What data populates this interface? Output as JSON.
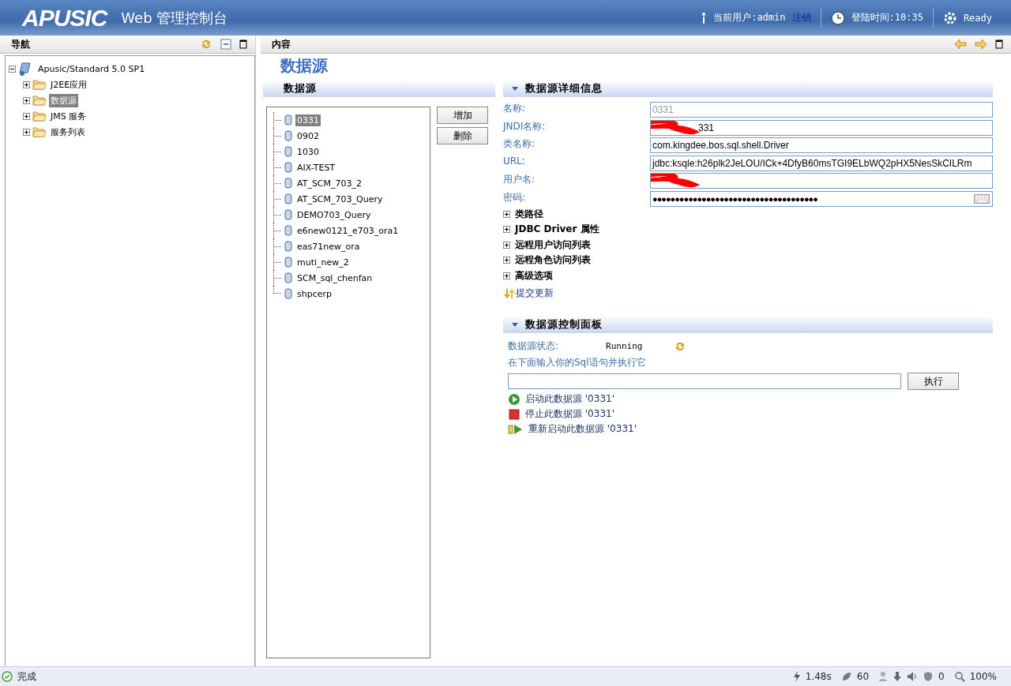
{
  "header": {
    "logo": "APUSIC",
    "title": "Web 管理控制台",
    "user_label": "当前用户:admin",
    "logout": "注销",
    "login_time": "登陆时间:10:35",
    "status": "Ready"
  },
  "nav": {
    "title": "导航",
    "tree": {
      "label": "Apusic/Standard 5.0 SP1",
      "expanded": true,
      "children": [
        {
          "label": "J2EE应用",
          "expanded": false,
          "selected": false
        },
        {
          "label": "数据源",
          "expanded": false,
          "selected": true
        },
        {
          "label": "JMS 服务",
          "expanded": false,
          "selected": false
        },
        {
          "label": "服务列表",
          "expanded": false,
          "selected": false
        }
      ]
    }
  },
  "content": {
    "title": "内容",
    "page_title": "数据源",
    "list_panel": {
      "title": "数据源",
      "items": [
        {
          "label": "0331",
          "selected": true
        },
        {
          "label": "0902",
          "selected": false
        },
        {
          "label": "1030",
          "selected": false
        },
        {
          "label": "AIX-TEST",
          "selected": false
        },
        {
          "label": "AT_SCM_703_2",
          "selected": false
        },
        {
          "label": "AT_SCM_703_Query",
          "selected": false
        },
        {
          "label": "DEMO703_Query",
          "selected": false
        },
        {
          "label": "e6new0121_e703_ora1",
          "selected": false
        },
        {
          "label": "eas71new_ora",
          "selected": false
        },
        {
          "label": "muti_new_2",
          "selected": false
        },
        {
          "label": "SCM_sql_chenfan",
          "selected": false
        },
        {
          "label": "shpcerp",
          "selected": false
        }
      ],
      "buttons": [
        "增加",
        "删除"
      ]
    },
    "detail_panel": {
      "title": "数据源详细信息",
      "expanded": true,
      "fields": [
        {
          "label": "名称:",
          "value": "0331",
          "kind": "disabled",
          "redacted": false
        },
        {
          "label": "JNDI名称:",
          "value": "331",
          "kind": "text",
          "redacted": true
        },
        {
          "label": "类名称:",
          "value": "com.kingdee.bos.sql.shell.Driver",
          "kind": "text",
          "redacted": false
        },
        {
          "label": "URL:",
          "value": "jdbc:ksqle:h26plk2JeLOU/ICk+4DfyB60msTGI9ELbWQ2pHX5NesSkCILRm",
          "kind": "text",
          "redacted": false
        },
        {
          "label": "用户名:",
          "kind": "text",
          "redacted": true
        },
        {
          "label": "密码:",
          "value": "●●●●●●●●●●●●●●●●●●●●●●●●●●●●●●●●●●●●●",
          "kind": "password",
          "redacted": false
        }
      ],
      "sections": [
        {
          "label": "类路径",
          "expanded": false
        },
        {
          "label": "JDBC Driver 属性",
          "expanded": false
        },
        {
          "label": "远程用户访问列表",
          "expanded": false
        },
        {
          "label": "远程角色访问列表",
          "expanded": false
        },
        {
          "label": "高级选项",
          "expanded": false
        }
      ],
      "submit": "提交更新"
    },
    "control_panel": {
      "title": "数据源控制面板",
      "expanded": true,
      "status_label": "数据源状态:",
      "status": "Running",
      "sql_hint": "在下面输入你的Sql语句并执行它",
      "execute": "执行",
      "actions": [
        {
          "kind": "start",
          "label": "启动此数据源 '0331'"
        },
        {
          "kind": "stop",
          "label": "停止此数据源 '0331'"
        },
        {
          "kind": "restart",
          "label": "重新启动此数据源 '0331'"
        }
      ]
    }
  },
  "status_bar": {
    "text": "完成",
    "time": "1.48s",
    "count": "60",
    "blocked": "0",
    "zoom": "100%"
  }
}
